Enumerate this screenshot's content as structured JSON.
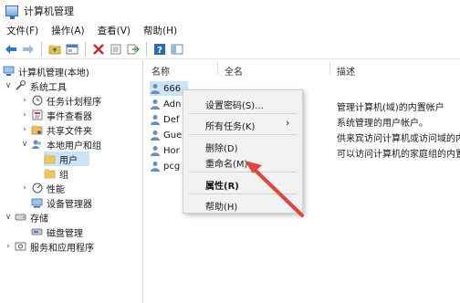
{
  "window": {
    "title": "计算机管理"
  },
  "menu": [
    "文件(F)",
    "操作(A)",
    "查看(V)",
    "帮助(H)"
  ],
  "toolbar_icons": [
    "back-arrow-icon",
    "forward-arrow-icon",
    "up-folder-icon",
    "console-icon",
    "delete-icon",
    "properties-icon",
    "export-icon",
    "refresh-icon",
    "help-icon",
    "panel-icon"
  ],
  "tree": [
    "计算机管理(本地)",
    "系统工具",
    "任务计划程序",
    "事件查看器",
    "共享文件夹",
    "本地用户和组",
    "用户",
    "组",
    "性能",
    "设备管理器",
    "存储",
    "磁盘管理",
    "服务和应用程序"
  ],
  "columns": [
    "名称",
    "全名",
    "描述"
  ],
  "rows": [
    {
      "name": "666",
      "desc": ""
    },
    {
      "name": "Adn",
      "desc": "管理计算机(域)的内置帐户"
    },
    {
      "name": "Def",
      "desc": "系统管理的用户帐户。"
    },
    {
      "name": "Gue",
      "desc": "供来宾访问计算机或访问域的内"
    },
    {
      "name": "Hor",
      "desc": "可以访问计算机的家庭组的内置"
    },
    {
      "name": "pcg",
      "desc": ""
    }
  ],
  "context_menu": [
    "设置密码(S)...",
    "所有任务(K)",
    "删除(D)",
    "重命名(M)",
    "属性(R)",
    "帮助(H)"
  ],
  "colors": {
    "selection": "#cce4f7",
    "arrow": "#e2453a",
    "accent": "#2b6cb0"
  }
}
